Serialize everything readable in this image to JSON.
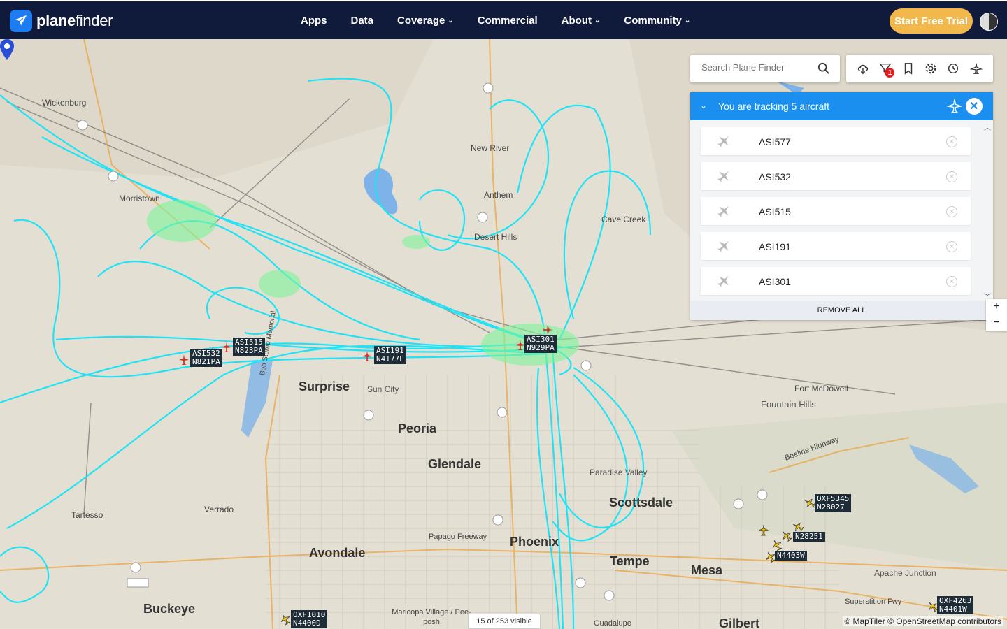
{
  "nav": {
    "brand_part1": "plane",
    "brand_part2": "finder",
    "items": [
      {
        "label": "Apps",
        "dropdown": false
      },
      {
        "label": "Data",
        "dropdown": false
      },
      {
        "label": "Coverage",
        "dropdown": true
      },
      {
        "label": "Commercial",
        "dropdown": false
      },
      {
        "label": "About",
        "dropdown": true
      },
      {
        "label": "Community",
        "dropdown": true
      }
    ],
    "cta_label": "Start Free Trial"
  },
  "search": {
    "placeholder": "Search Plane Finder"
  },
  "tools": {
    "filter_badge": "1"
  },
  "tracking": {
    "title": "You are tracking 5 aircraft",
    "aircraft": [
      "ASI577",
      "ASI532",
      "ASI515",
      "ASI191",
      "ASI301"
    ],
    "remove_all_label": "REMOVE ALL"
  },
  "map": {
    "places": [
      {
        "name": "Wickenburg",
        "type": "small"
      },
      {
        "name": "Morristown",
        "type": "small"
      },
      {
        "name": "New River",
        "type": "small"
      },
      {
        "name": "Anthem",
        "type": "small"
      },
      {
        "name": "Desert Hills",
        "type": "small"
      },
      {
        "name": "Cave Creek",
        "type": "small"
      },
      {
        "name": "Fort McDowell",
        "type": "small"
      },
      {
        "name": "Fountain Hills",
        "type": "med"
      },
      {
        "name": "Surprise",
        "type": "city"
      },
      {
        "name": "Sun City",
        "type": "med"
      },
      {
        "name": "Peoria",
        "type": "city"
      },
      {
        "name": "Glendale",
        "type": "city"
      },
      {
        "name": "Paradise Valley",
        "type": "med"
      },
      {
        "name": "Scottsdale",
        "type": "city"
      },
      {
        "name": "Phoenix",
        "type": "city"
      },
      {
        "name": "Tempe",
        "type": "city"
      },
      {
        "name": "Mesa",
        "type": "city"
      },
      {
        "name": "Avondale",
        "type": "city"
      },
      {
        "name": "Buckeye",
        "type": "city"
      },
      {
        "name": "Verrado",
        "type": "small"
      },
      {
        "name": "Tartesso",
        "type": "small"
      },
      {
        "name": "Papago Freeway",
        "type": "small"
      },
      {
        "name": "Apache Junction",
        "type": "med"
      },
      {
        "name": "Superstition Fwy",
        "type": "small"
      },
      {
        "name": "Beeline Highway",
        "type": "small"
      },
      {
        "name": "Bob Stump Memorial",
        "type": "small"
      },
      {
        "name": "Maricopa Village / Pee-posh",
        "type": "small"
      },
      {
        "name": "Guadalupe",
        "type": "small"
      },
      {
        "name": "Gilbert",
        "type": "city"
      }
    ],
    "aircraft_labels": [
      {
        "callsign": "ASI532",
        "reg": "N821PA"
      },
      {
        "callsign": "ASI515",
        "reg": "N823PA"
      },
      {
        "callsign": "ASI191",
        "reg": "N4177L"
      },
      {
        "callsign": "ASI301",
        "reg": "N929PA"
      },
      {
        "callsign": "OXF5345",
        "reg": "N28027"
      },
      {
        "callsign": "",
        "reg": "N28251"
      },
      {
        "callsign": "",
        "reg": "N4403W"
      },
      {
        "callsign": "OXF1010",
        "reg": "N4400D"
      },
      {
        "callsign": "OXF4263",
        "reg": "N4401W"
      }
    ],
    "visible_count": "15 of 253 visible",
    "attribution": "© MapTiler © OpenStreetMap contributors"
  },
  "colors": {
    "nav_bg": "#101a3a",
    "cta": "#f2b84b",
    "track": "#1fe3f5",
    "panel_head": "#1b8ff0"
  }
}
